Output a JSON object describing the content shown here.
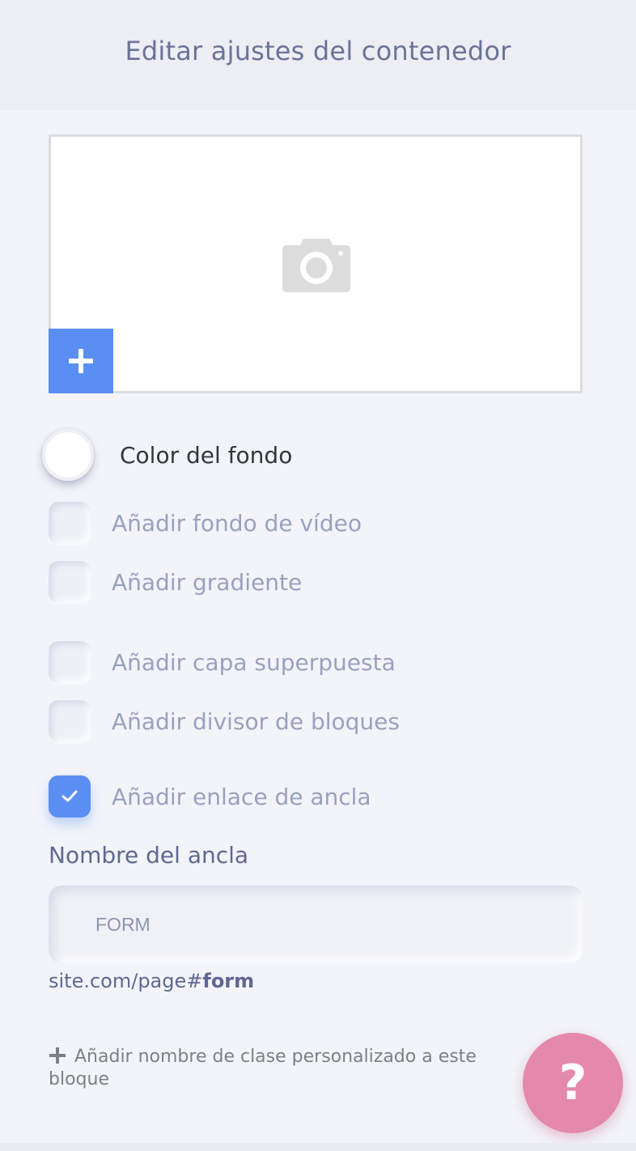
{
  "header": {
    "title": "Editar ajustes del contenedor"
  },
  "image_picker": {
    "placeholder_icon": "camera-icon",
    "add_icon": "plus-icon",
    "accent_color": "#5b8ef2"
  },
  "background_color": {
    "label": "Color del fondo",
    "swatch_color": "#ffffff"
  },
  "options": [
    {
      "label": "Añadir fondo de vídeo",
      "checked": false
    },
    {
      "label": "Añadir gradiente",
      "checked": false
    },
    {
      "label": "Añadir capa superpuesta",
      "checked": false
    },
    {
      "label": "Añadir divisor de bloques",
      "checked": false
    },
    {
      "label": "Añadir enlace de ancla",
      "checked": true
    }
  ],
  "anchor": {
    "title": "Nombre del ancla",
    "value": "FORM",
    "url_prefix": "site.com/page#",
    "url_slug": "form"
  },
  "custom_class": {
    "label": "Añadir nombre de clase personalizado a este bloque"
  },
  "help": {
    "label": "?",
    "color": "#e589aa"
  }
}
